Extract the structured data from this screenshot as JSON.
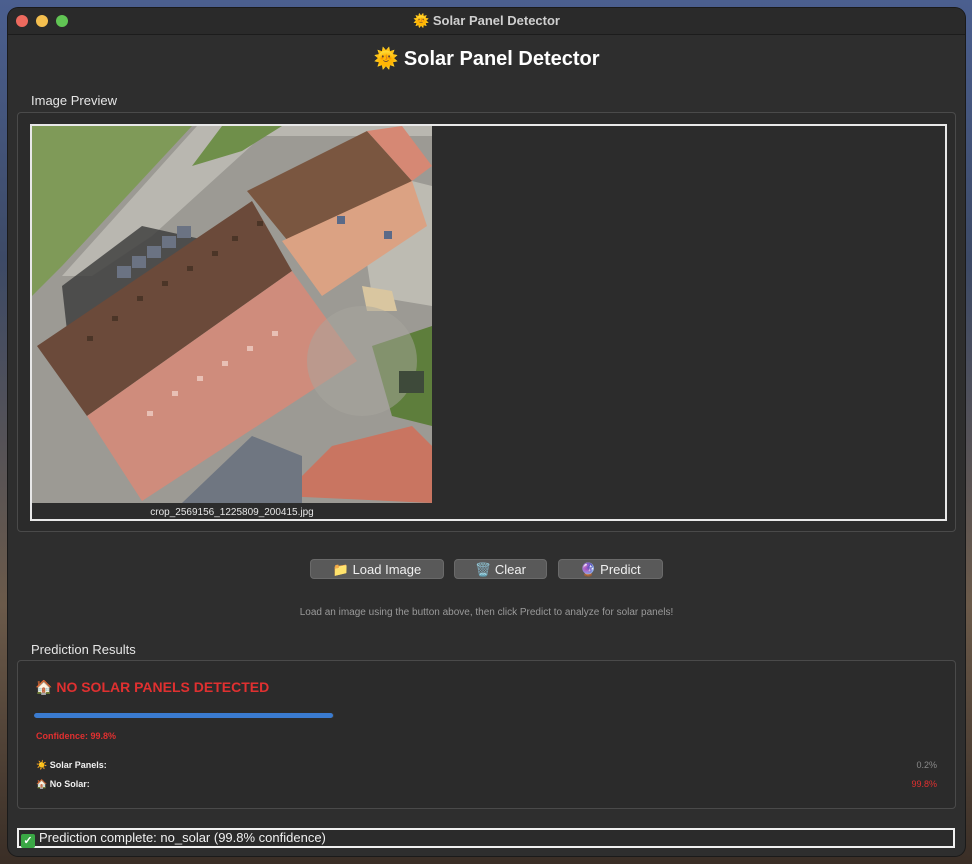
{
  "window": {
    "title": "Solar Panel Detector",
    "title_icon": "sun-icon"
  },
  "app": {
    "heading": "Solar Panel Detector",
    "heading_icon": "sun-icon"
  },
  "preview": {
    "section_label": "Image Preview",
    "filename": "crop_2569156_1225809_200415.jpg"
  },
  "buttons": [
    {
      "label": "Load Image",
      "icon": "folder-icon"
    },
    {
      "label": "Clear",
      "icon": "trash-icon"
    },
    {
      "label": "Predict",
      "icon": "crystal-ball-icon"
    }
  ],
  "hint": "Load an image using the button above, then click Predict to analyze for solar panels!",
  "results": {
    "section_label": "Prediction Results",
    "headline": "NO SOLAR PANELS DETECTED",
    "headline_icon": "house-icon",
    "confidence_text": "Confidence: 99.8%",
    "confidence_fraction": 0.998,
    "rows": [
      {
        "label": "Solar Panels:",
        "icon": "sun-icon",
        "value": "0.2%"
      },
      {
        "label": "No Solar:",
        "icon": "house-icon",
        "value": "99.8%"
      }
    ]
  },
  "status": {
    "text": "Prediction complete: no_solar (99.8% confidence)",
    "icon": "check-icon"
  },
  "colors": {
    "alert_red": "#e03030",
    "progress_blue": "#3a7bd0",
    "window_bg": "#2e2e2e"
  }
}
